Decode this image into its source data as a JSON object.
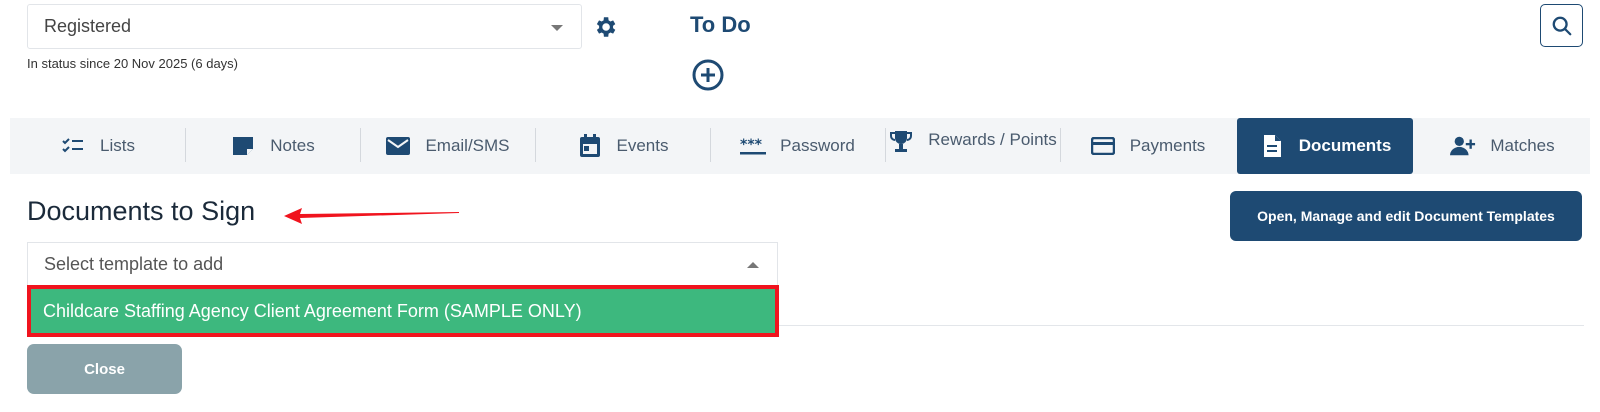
{
  "status": {
    "selected": "Registered",
    "since": "In status since 20 Nov 2025 (6 days)"
  },
  "todo": {
    "title": "To Do"
  },
  "tabs": [
    {
      "label": "Lists",
      "icon": "checklist-icon"
    },
    {
      "label": "Notes",
      "icon": "note-icon"
    },
    {
      "label": "Email/SMS",
      "icon": "envelope-icon"
    },
    {
      "label": "Events",
      "icon": "calendar-icon"
    },
    {
      "label": "Password",
      "icon": "asterisks-icon"
    },
    {
      "label": "Rewards / Points",
      "icon": "trophy-icon"
    },
    {
      "label": "Payments",
      "icon": "credit-card-icon"
    },
    {
      "label": "Documents",
      "icon": "document-icon",
      "active": true
    },
    {
      "label": "Matches",
      "icon": "user-plus-icon"
    }
  ],
  "documents": {
    "heading": "Documents to Sign",
    "templates_button": "Open, Manage and edit Document Templates",
    "select_placeholder": "Select template to add",
    "option": "Childcare Staffing Agency Client Agreement Form (SAMPLE ONLY)",
    "close_button": "Close"
  },
  "colors": {
    "primary": "#1e4a73",
    "option_green": "#3db87e",
    "highlight_red": "#f0141e",
    "close_gray": "#8aa3aa"
  }
}
